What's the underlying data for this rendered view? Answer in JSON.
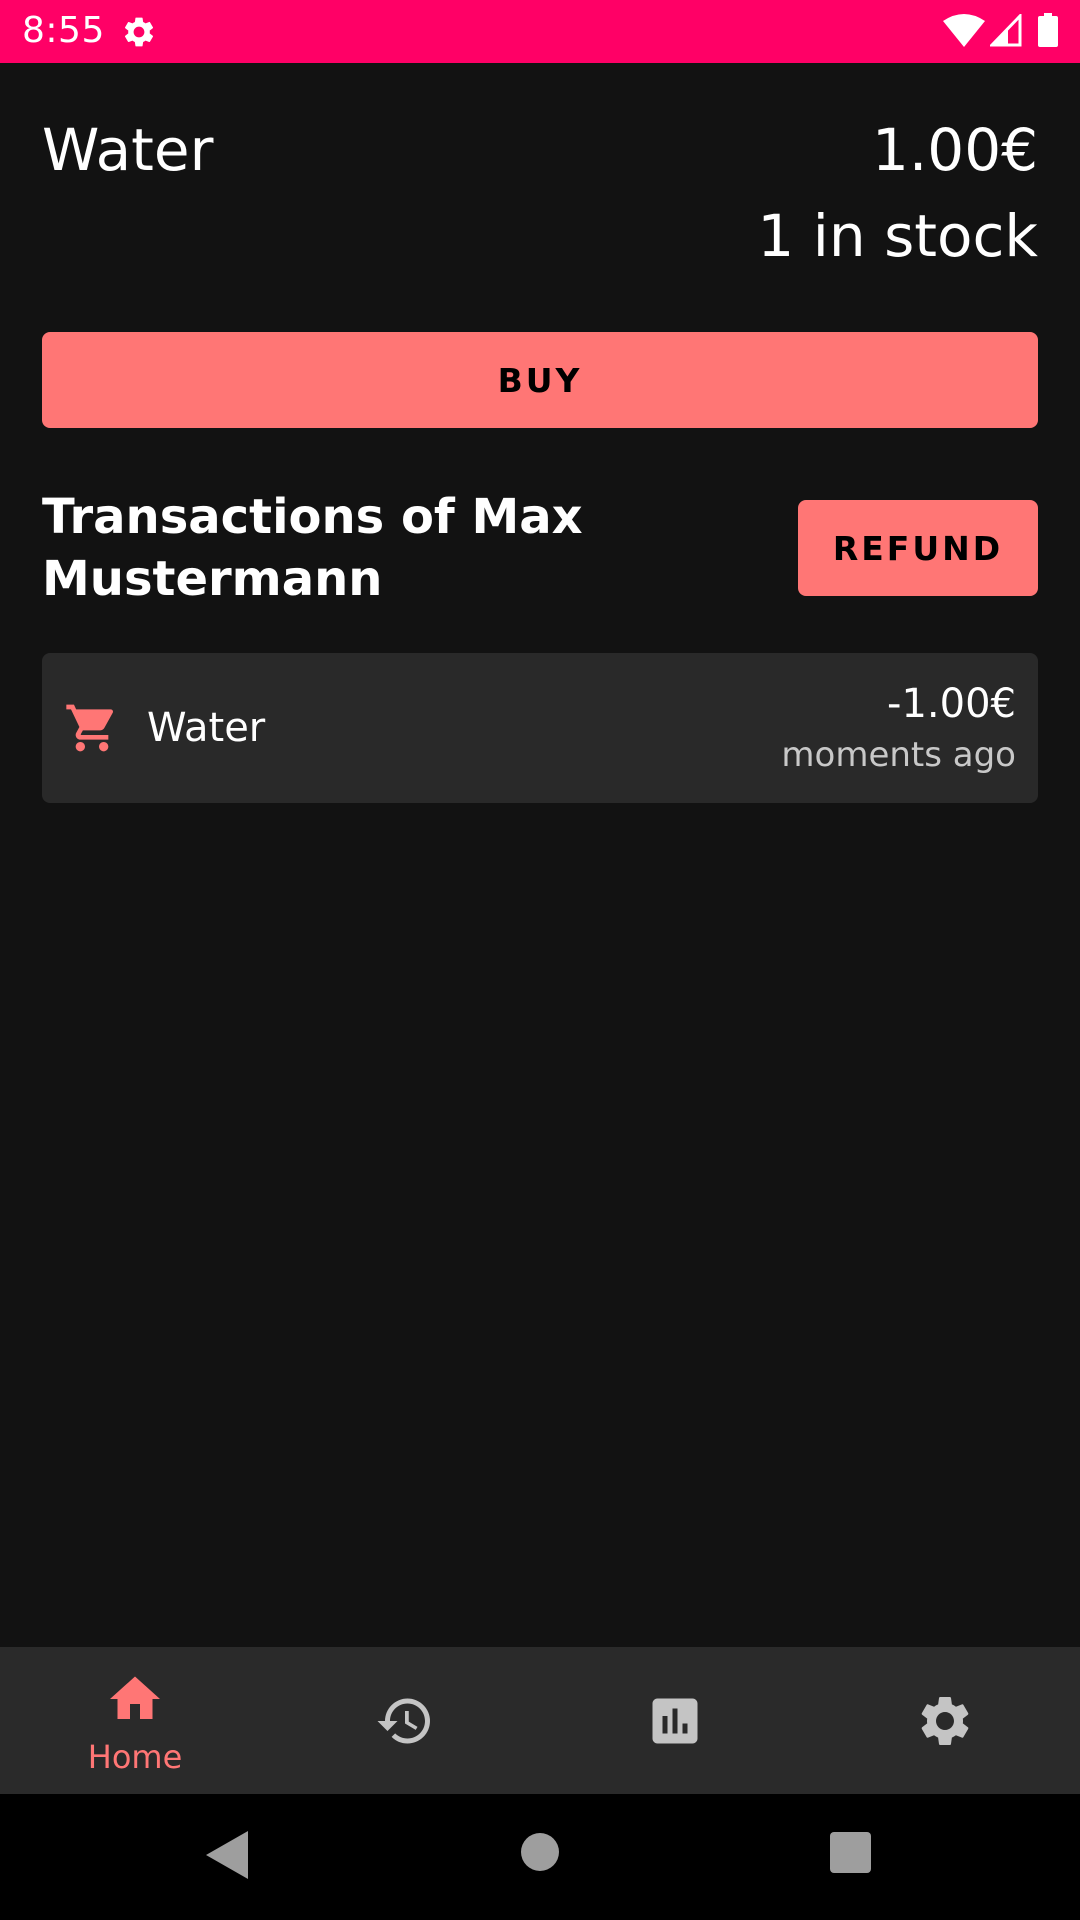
{
  "status_bar": {
    "time": "8:55",
    "background_color": "#ff0066",
    "icons": [
      "gear-icon",
      "wifi-icon",
      "signal-icon",
      "battery-icon"
    ]
  },
  "product": {
    "name": "Water",
    "price": "1.00€",
    "stock": "1 in stock"
  },
  "actions": {
    "buy_label": "BUY",
    "refund_label": "REFUND",
    "accent_color": "#ff7675"
  },
  "transactions": {
    "title": "Transactions of Max Mustermann",
    "items": [
      {
        "icon": "cart-icon",
        "name": "Water",
        "amount": "-1.00€",
        "time": "moments ago"
      }
    ]
  },
  "bottom_nav": {
    "items": [
      {
        "icon": "home-icon",
        "label": "Home",
        "active": true
      },
      {
        "icon": "history-icon",
        "label": "",
        "active": false
      },
      {
        "icon": "bar-chart-icon",
        "label": "",
        "active": false
      },
      {
        "icon": "settings-icon",
        "label": "",
        "active": false
      }
    ]
  },
  "system_nav": {
    "icons": [
      "back-icon",
      "home-circle-icon",
      "recents-icon"
    ]
  }
}
